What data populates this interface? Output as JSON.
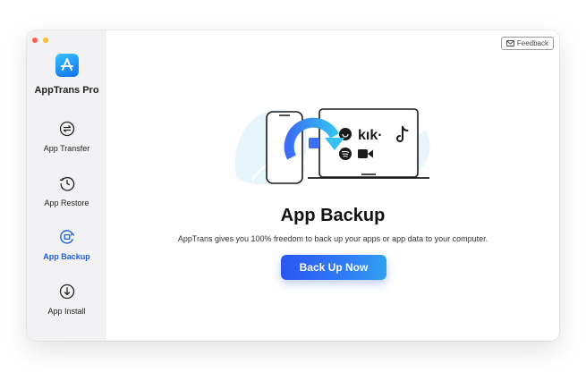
{
  "window": {
    "controls": [
      "close",
      "minimize"
    ]
  },
  "sidebar": {
    "app_name": "AppTrans Pro",
    "logo_icon": "app-store-icon",
    "items": [
      {
        "label": "App Transfer",
        "icon": "transfer-icon",
        "active": false
      },
      {
        "label": "App Restore",
        "icon": "restore-icon",
        "active": false
      },
      {
        "label": "App Backup",
        "icon": "backup-icon",
        "active": true
      },
      {
        "label": "App Install",
        "icon": "install-icon",
        "active": false
      }
    ]
  },
  "header": {
    "feedback_label": "Feedback"
  },
  "main": {
    "title": "App Backup",
    "subtitle": "AppTrans gives you 100% freedom to back up your apps or app data to your computer.",
    "cta_label": "Back Up Now",
    "illustration_text": "kık·"
  },
  "colors": {
    "accent": "#1d5fe0",
    "button": "#2f6bf2",
    "close": "#ff5f57",
    "minimize": "#febc2e"
  }
}
